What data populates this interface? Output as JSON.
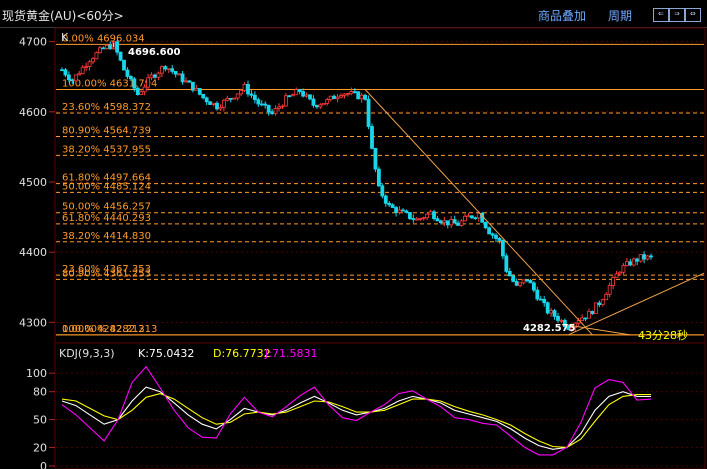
{
  "header": {
    "title": "现货黄金(AU)<60分>",
    "btn_overlay": "商品叠加",
    "btn_period": "周期",
    "nav": [
      "⇐",
      "⇒",
      "⇔"
    ]
  },
  "colors": {
    "bg": "#000000",
    "grid": "#4a0000",
    "up": "#ff3b3b",
    "down": "#19d6ea",
    "fib_line": "#ff9a2b",
    "trend": "#f0a24a",
    "k": "#ffffff",
    "d": "#ffff00",
    "j": "#ff00ff"
  },
  "main_panel": {
    "label": "K",
    "price_high_label": "4696.600",
    "price_low_label": "4282.575",
    "countdown": "43分28秒",
    "fib_levels": [
      {
        "text": "0.00%  4696.034",
        "price": 4696.034,
        "style": "solid"
      },
      {
        "text": "100.00%  4631.794",
        "price": 4631.794,
        "style": "solid"
      },
      {
        "text": "23.60%  4598.372",
        "price": 4598.372,
        "style": "dashed"
      },
      {
        "text": "80.90%  4564.739",
        "price": 4564.739,
        "style": "dashed"
      },
      {
        "text": "38.20%  4537.955",
        "price": 4537.955,
        "style": "dashed"
      },
      {
        "text": "61.80%  4497.664",
        "price": 4497.664,
        "style": "dashed"
      },
      {
        "text": "50.00%  4485.124",
        "price": 4485.124,
        "style": "dashed"
      },
      {
        "text": "50.00%  4456.257",
        "price": 4456.257,
        "style": "dashed"
      },
      {
        "text": "61.80%  4440.293",
        "price": 4440.293,
        "style": "dashed"
      },
      {
        "text": "38.20%  4414.830",
        "price": 4414.83,
        "style": "dashed"
      },
      {
        "text": "23.60%  4367.353",
        "price": 4367.353,
        "style": "dashed"
      },
      {
        "text": "80.90%  4361.253",
        "price": 4361.253,
        "style": "dashed"
      },
      {
        "text": "100.00%  4282.213",
        "price": 4282.213,
        "style": "solid"
      },
      {
        "text": "0.00%  4282.213",
        "price": 4282.213,
        "style": "solid"
      }
    ]
  },
  "chart_data": [
    {
      "type": "candlestick",
      "title": "现货黄金(AU)<60分>",
      "ylim": [
        4272,
        4718
      ],
      "yticks": [
        4300,
        4400,
        4500,
        4600,
        4700
      ],
      "keypoints": [
        [
          0,
          4660
        ],
        [
          3,
          4645
        ],
        [
          8,
          4675
        ],
        [
          12,
          4690
        ],
        [
          15,
          4696
        ],
        [
          18,
          4660
        ],
        [
          22,
          4625
        ],
        [
          26,
          4650
        ],
        [
          30,
          4666
        ],
        [
          34,
          4650
        ],
        [
          38,
          4635
        ],
        [
          41,
          4620
        ],
        [
          45,
          4608
        ],
        [
          49,
          4620
        ],
        [
          53,
          4635
        ],
        [
          57,
          4612
        ],
        [
          61,
          4597
        ],
        [
          65,
          4618
        ],
        [
          69,
          4630
        ],
        [
          73,
          4610
        ],
        [
          77,
          4615
        ],
        [
          81,
          4628
        ],
        [
          85,
          4624
        ],
        [
          88,
          4620
        ],
        [
          90,
          4545
        ],
        [
          92,
          4490
        ],
        [
          95,
          4465
        ],
        [
          99,
          4455
        ],
        [
          103,
          4446
        ],
        [
          107,
          4456
        ],
        [
          111,
          4443
        ],
        [
          115,
          4440
        ],
        [
          118,
          4450
        ],
        [
          121,
          4455
        ],
        [
          124,
          4430
        ],
        [
          127,
          4415
        ],
        [
          129,
          4375
        ],
        [
          132,
          4350
        ],
        [
          135,
          4362
        ],
        [
          138,
          4338
        ],
        [
          141,
          4316
        ],
        [
          144,
          4306
        ],
        [
          147,
          4294
        ],
        [
          150,
          4305
        ],
        [
          153,
          4312
        ],
        [
          156,
          4328
        ],
        [
          159,
          4352
        ],
        [
          162,
          4375
        ],
        [
          165,
          4385
        ],
        [
          168,
          4392
        ],
        [
          171,
          4392
        ]
      ]
    },
    {
      "type": "line",
      "title": "KDJ(9,3,3)",
      "ylim": [
        0,
        112
      ],
      "yticks": [
        0,
        20,
        50,
        80,
        100
      ],
      "values_label": {
        "k": "K:75.0432",
        "d": "D:76.7732",
        "j": "J:71.5831"
      },
      "series": [
        {
          "name": "K",
          "values": [
            70,
            65,
            55,
            45,
            50,
            70,
            85,
            80,
            68,
            55,
            45,
            40,
            50,
            62,
            58,
            55,
            60,
            68,
            75,
            68,
            60,
            55,
            58,
            62,
            70,
            75,
            72,
            68,
            60,
            56,
            52,
            48,
            40,
            30,
            22,
            18,
            20,
            35,
            60,
            75,
            80,
            75,
            75
          ]
        },
        {
          "name": "D",
          "values": [
            72,
            70,
            62,
            54,
            50,
            60,
            74,
            78,
            72,
            62,
            52,
            45,
            47,
            56,
            58,
            56,
            58,
            64,
            70,
            69,
            64,
            58,
            58,
            60,
            66,
            72,
            72,
            70,
            64,
            59,
            55,
            50,
            44,
            35,
            27,
            21,
            20,
            29,
            48,
            66,
            75,
            77,
            77
          ]
        },
        {
          "name": "J",
          "values": [
            66,
            55,
            41,
            27,
            50,
            90,
            107,
            84,
            60,
            41,
            31,
            30,
            56,
            74,
            58,
            53,
            64,
            76,
            85,
            66,
            52,
            49,
            58,
            66,
            78,
            81,
            72,
            64,
            52,
            50,
            46,
            44,
            32,
            20,
            12,
            12,
            20,
            47,
            84,
            93,
            90,
            71,
            72
          ]
        }
      ]
    }
  ]
}
